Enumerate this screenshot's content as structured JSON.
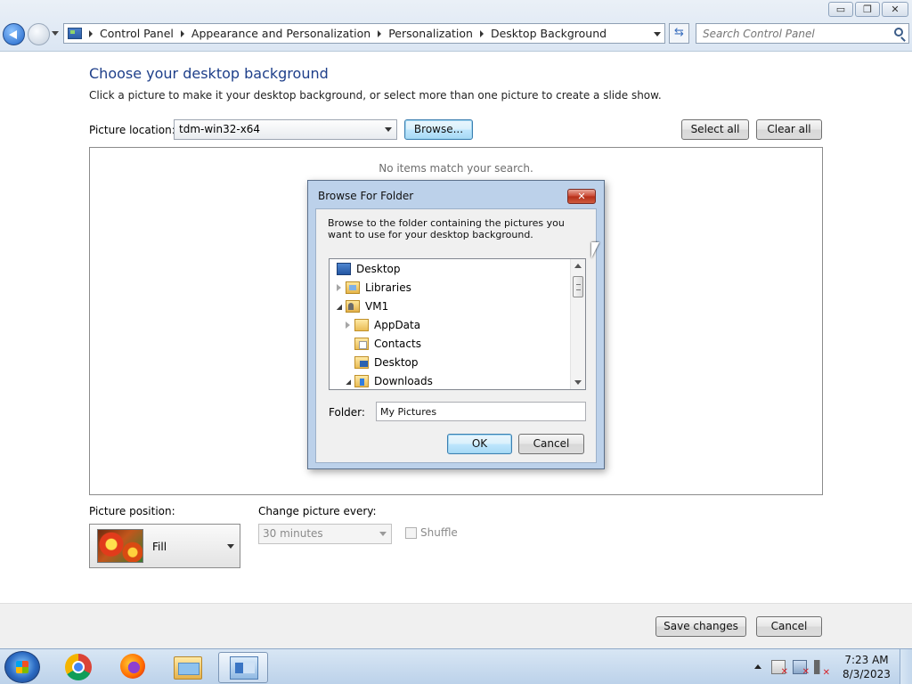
{
  "window": {
    "minimize_glyph": "▭",
    "maximize_glyph": "❐",
    "close_glyph": "✕"
  },
  "address_bar": {
    "breadcrumbs": [
      "Control Panel",
      "Appearance and Personalization",
      "Personalization",
      "Desktop Background"
    ]
  },
  "search": {
    "placeholder": "Search Control Panel"
  },
  "main": {
    "heading": "Choose your desktop background",
    "description": "Click a picture to make it your desktop background, or select more than one picture to create a slide show.",
    "picture_location_label": "Picture location:",
    "picture_location_value": "tdm-win32-x64",
    "browse_label": "Browse...",
    "select_all_label": "Select all",
    "clear_all_label": "Clear all",
    "no_items_text": "No items match your search.",
    "picture_position_label": "Picture position:",
    "picture_position_value": "Fill",
    "change_picture_label": "Change picture every:",
    "change_picture_value": "30 minutes",
    "shuffle_label": "Shuffle",
    "save_label": "Save changes",
    "cancel_label": "Cancel"
  },
  "dialog": {
    "title": "Browse For Folder",
    "close_glyph": "✕",
    "instructions": "Browse to the folder containing the pictures you want to use for your desktop background.",
    "tree_items": [
      "Desktop",
      "Libraries",
      "VM1",
      "AppData",
      "Contacts",
      "Desktop",
      "Downloads"
    ],
    "folder_label": "Folder:",
    "folder_value": "My Pictures",
    "ok_label": "OK",
    "cancel_label": "Cancel"
  },
  "taskbar": {
    "time": "7:23 AM",
    "date": "8/3/2023"
  }
}
